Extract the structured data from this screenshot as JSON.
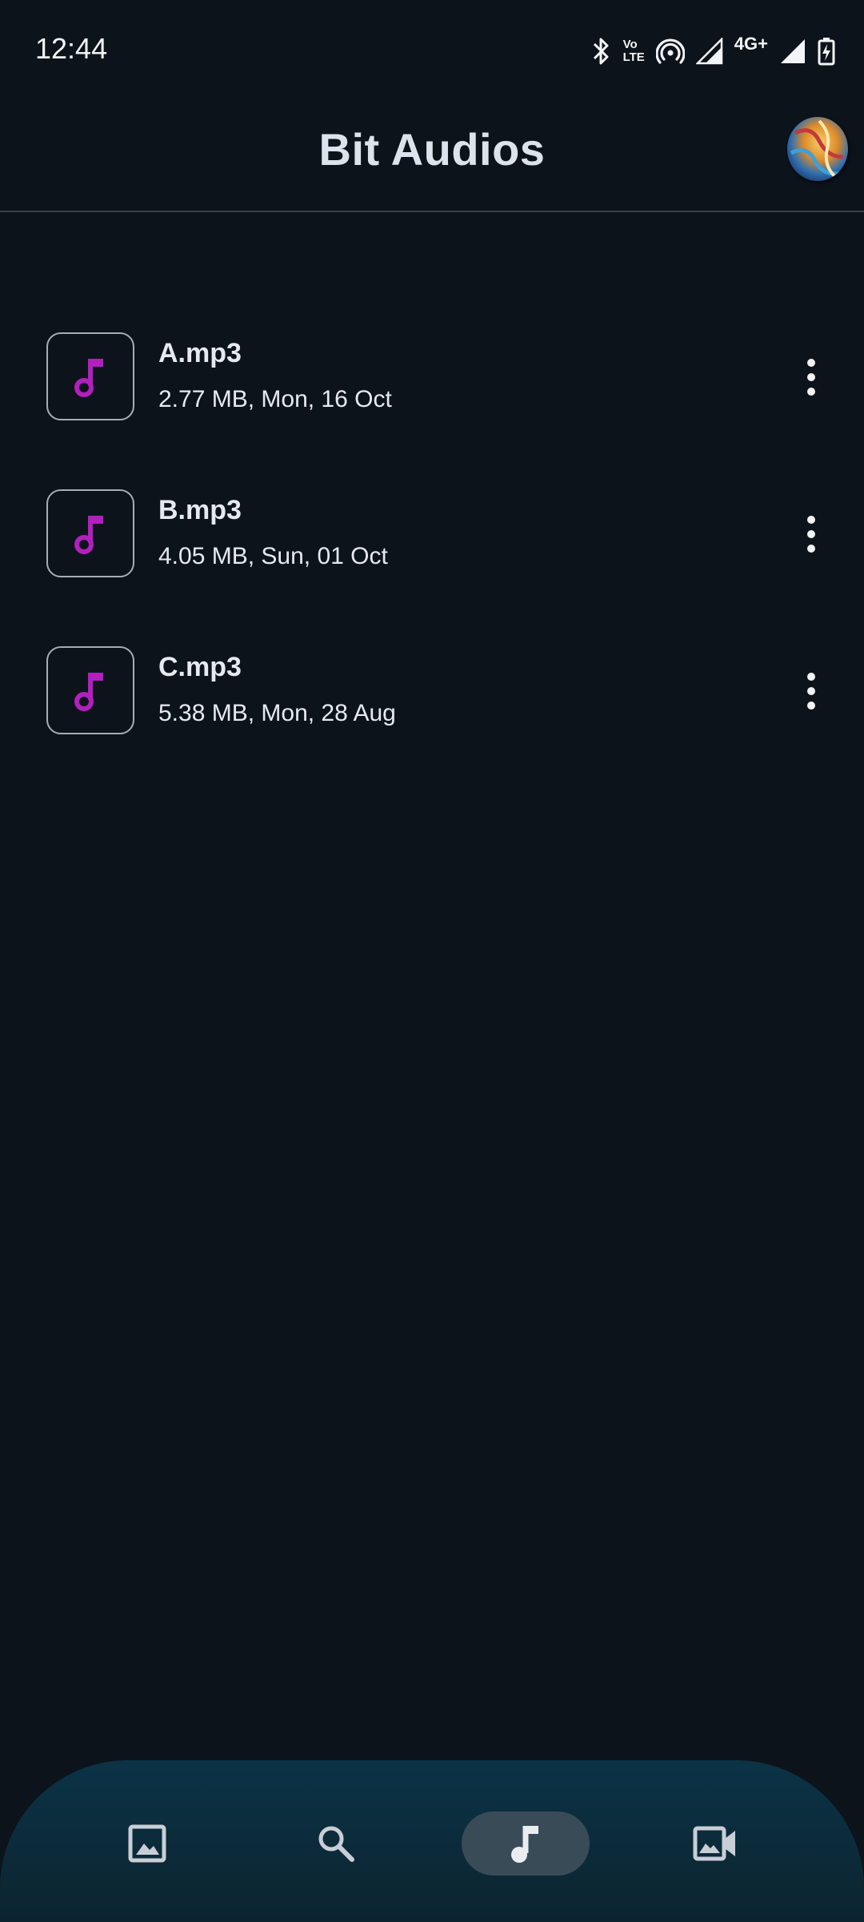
{
  "status_bar": {
    "time": "12:44",
    "icons": [
      "bluetooth-icon",
      "volte-icon",
      "hotspot-icon",
      "signal-icon",
      "signal-icon",
      "battery-charging-icon"
    ],
    "volte_top": "Vo",
    "volte_bottom": "LTE",
    "network_label": "4G+"
  },
  "app_bar": {
    "title": "Bit Audios",
    "avatar": "profile-avatar"
  },
  "colors": {
    "background": "#0d131a",
    "accent_note": "#b31fbf",
    "nav_bar": "#0b3346",
    "nav_active_pill": "#3a4b58"
  },
  "files": [
    {
      "name": "A.mp3",
      "meta": "2.77 MB, Mon, 16 Oct",
      "icon": "music-note-icon"
    },
    {
      "name": "B.mp3",
      "meta": "4.05 MB, Sun, 01 Oct",
      "icon": "music-note-icon"
    },
    {
      "name": "C.mp3",
      "meta": "5.38 MB, Mon, 28 Aug",
      "icon": "music-note-icon"
    }
  ],
  "bottom_nav": {
    "items": [
      {
        "icon": "image-icon",
        "active": false
      },
      {
        "icon": "search-icon",
        "active": false
      },
      {
        "icon": "music-note-icon",
        "active": true
      },
      {
        "icon": "video-icon",
        "active": false
      }
    ]
  }
}
